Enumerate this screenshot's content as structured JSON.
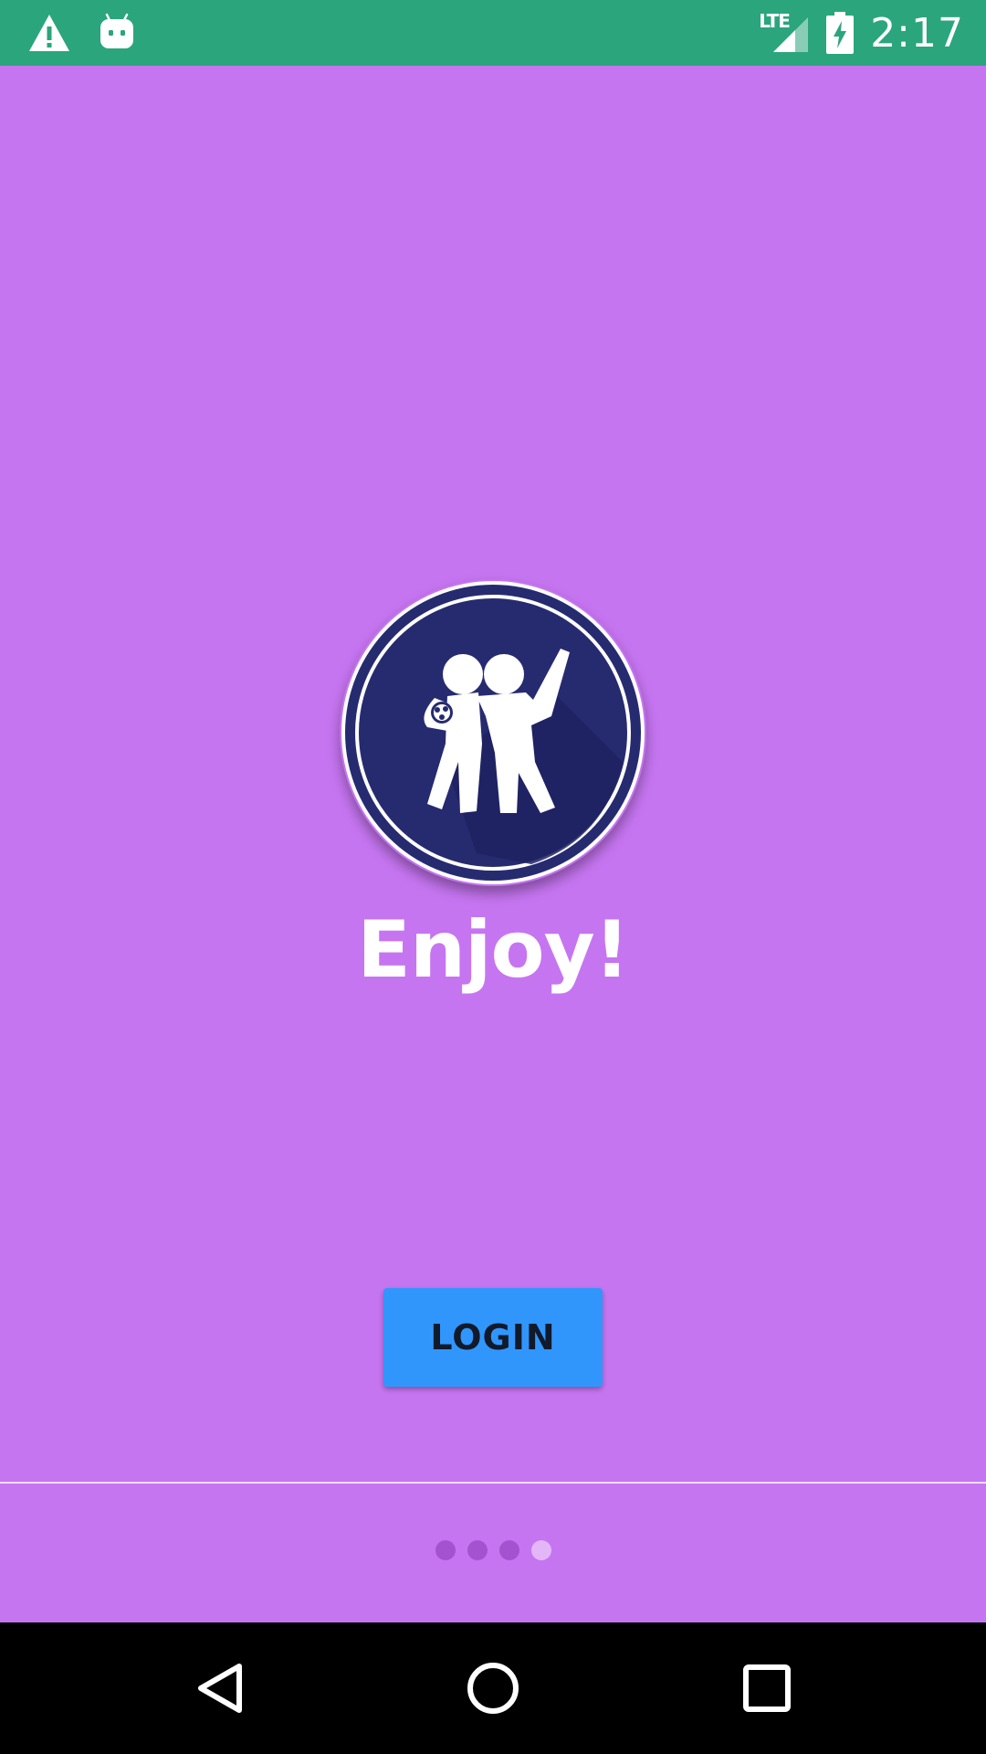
{
  "status_bar": {
    "time": "2:17",
    "network_label": "LTE",
    "icons": [
      "warning-icon",
      "android-icon",
      "signal-icon",
      "battery-charging-icon"
    ]
  },
  "onboarding": {
    "headline": "Enjoy!",
    "login_label": "LOGIN",
    "page_count": 4,
    "current_page": 4
  },
  "nav_bar": {
    "icons": [
      "back-icon",
      "home-icon",
      "recents-icon"
    ]
  },
  "colors": {
    "background": "#c675f1",
    "status_bar": "#2ba57c",
    "button": "#3196fc",
    "logo_circle": "#262b70"
  }
}
